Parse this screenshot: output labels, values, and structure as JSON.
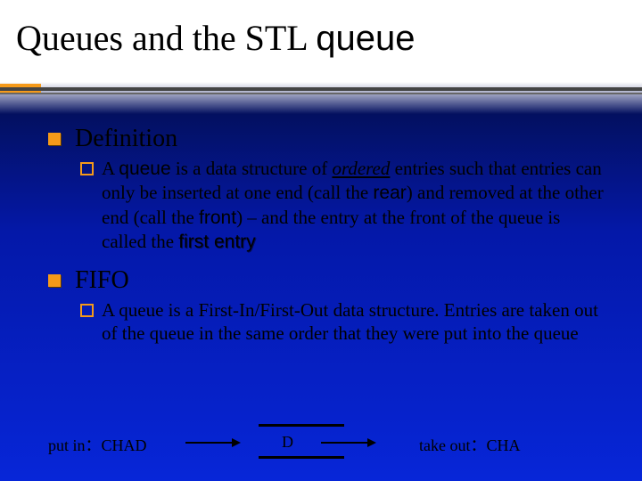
{
  "title_prefix": "Queues and the STL ",
  "title_code": "queue",
  "sections": [
    {
      "heading": "Definition",
      "body_html": "A <span class='sans'>queue</span> is a data structure of <em class='under'>ordered</em> entries such that entries can only be inserted at one end (call the <span class='sans'>rear</span>) and removed at the other end (call the <span class='sans'>front</span>) – and the entry at the front of the queue is called the <span class='sans shadspan'>first entry</span>"
    },
    {
      "heading": "FIFO",
      "body_html": "A queue is a First-In/First-Out data structure. Entries are taken out of the queue in the same order that they were put into the queue"
    }
  ],
  "diagram": {
    "put_in_label": "put in：CHAD",
    "middle_label": "D",
    "take_out_label": "take out：CHA"
  }
}
